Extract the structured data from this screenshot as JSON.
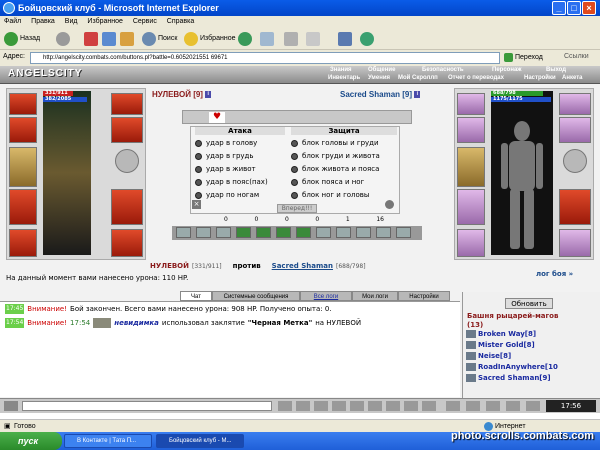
{
  "window": {
    "title": "Бойцовский клуб - Microsoft Internet Explorer",
    "min": "_",
    "max": "□",
    "close": "×"
  },
  "menu": [
    "Файл",
    "Правка",
    "Вид",
    "Избранное",
    "Сервис",
    "Справка"
  ],
  "toolbar": {
    "back": "Назад",
    "search": "Поиск",
    "favorites": "Избранное"
  },
  "address": {
    "label": "Адрес:",
    "url": "http://angelscity.combats.com/buttons.pl?battle=0.6052021551 69671",
    "go": "Переход",
    "links": "Ссылки"
  },
  "game": {
    "logo": "ANGELSCITY",
    "nav_top": [
      "Знания",
      "Общение",
      "Безопасность",
      "Персонаж",
      "Выход"
    ],
    "nav_bottom": [
      "Инвентарь",
      "Умения",
      "Мой Скроллп",
      "Отчет о переводах",
      "Настройки",
      "Анкета"
    ],
    "left_fighter": {
      "name": "НУЛЕВОЙ",
      "level": "[9]",
      "hp": "331/911",
      "mp": "382/2085"
    },
    "right_fighter": {
      "name": "Sacred Shaman",
      "level": "[9]",
      "hp": "688/798",
      "mp": "1175/1175"
    },
    "attack": {
      "header": "Атака",
      "options": [
        "удар в голову",
        "удар в грудь",
        "удар в живот",
        "удар в пояс(пах)",
        "удар по ногам"
      ]
    },
    "defense": {
      "header": "Защита",
      "options": [
        "блок головы и груди",
        "блок груди и живота",
        "блок живота и пояса",
        "блок пояса и ног",
        "блок ног и головы"
      ]
    },
    "go_button": "Вперед!!!",
    "counters": [
      "0",
      "0",
      "0",
      "0",
      "1",
      "16"
    ],
    "versus": {
      "left_name": "НУЛЕВОЙ",
      "left_hp": "[331/911]",
      "word": "против",
      "right_name": "Sacred Shaman",
      "right_hp": "[688/798]"
    },
    "damage_line": "На данный момент вами нанесено урона: 110 HP.",
    "battle_log_link": "лог боя »",
    "tabs": [
      "Чат",
      "Системные сообщения",
      "Все логи",
      "Мои логи",
      "Настройки"
    ],
    "chat": [
      {
        "time": "17:45",
        "warn": "Внимание!",
        "text": "Бой закончен. Всего вами нанесено урона: 908 HP. Получено опыта: 0."
      },
      {
        "time": "17:54",
        "warn": "Внимание!",
        "time2": "17:54",
        "actor": "невидимка",
        "text": "использовал заклятие",
        "spell": "\"Черная Метка\"",
        "target": "на НУЛЕВОЙ"
      }
    ],
    "refresh": "Обновить",
    "room": {
      "title": "Башня рыцарей-магов",
      "count": "(13)"
    },
    "members": [
      "Broken Way[8]",
      "Mister Gold[8]",
      "Neise[8]",
      "RoadInAnywhere[10",
      "Sacred Shaman[9]"
    ],
    "clock": "17:56"
  },
  "status": {
    "left": "Готово",
    "zone": "Интернет"
  },
  "taskbar": {
    "start": "пуск",
    "tasks": [
      "В Контакте | Тата П...",
      "Бойцовский клуб - М..."
    ]
  },
  "watermark": "photo.scrolls.combats.com"
}
